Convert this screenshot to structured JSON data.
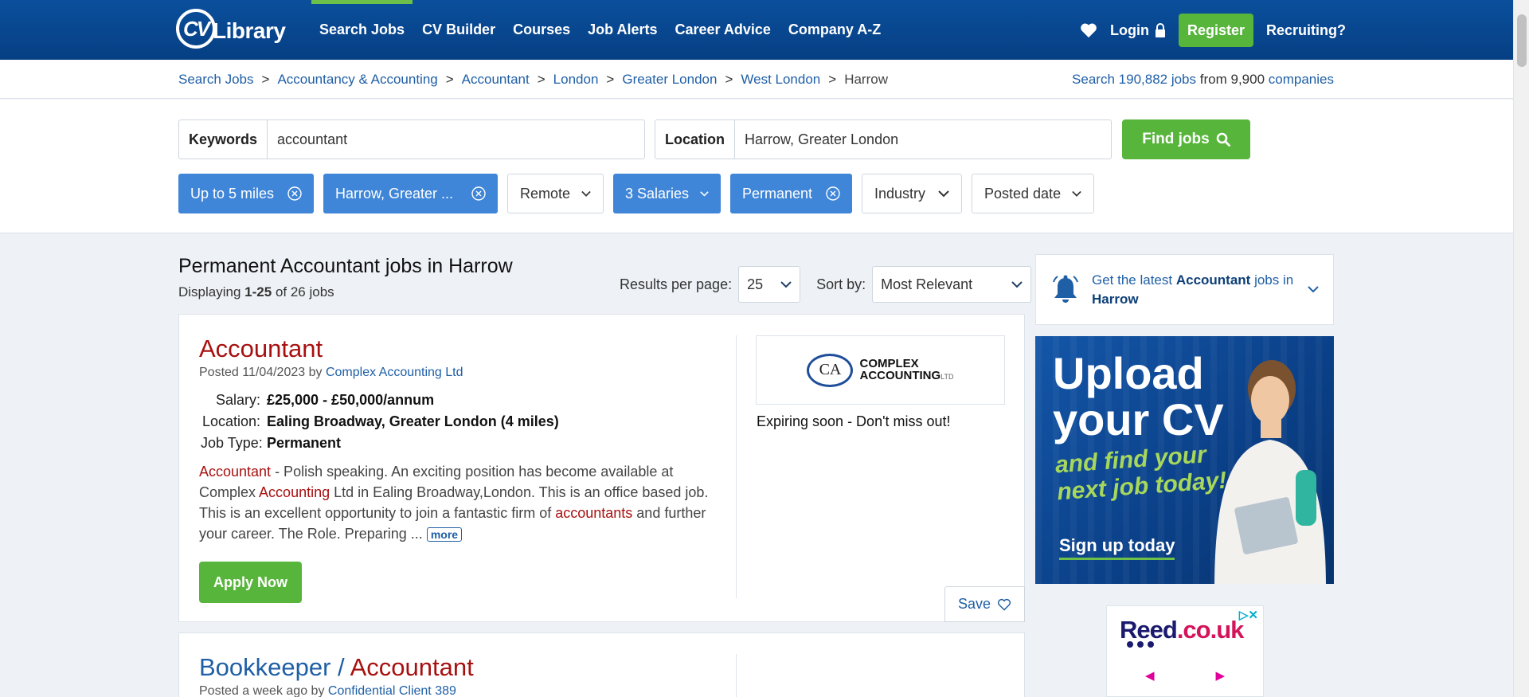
{
  "header": {
    "logo_text": "CV-Library",
    "logo_cv": "CV",
    "logo_library": "Library",
    "nav": [
      "Search Jobs",
      "CV Builder",
      "Courses",
      "Job Alerts",
      "Career Advice",
      "Company A-Z"
    ],
    "login": "Login",
    "register": "Register",
    "recruiting": "Recruiting?"
  },
  "breadcrumb": [
    "Search Jobs",
    "Accountancy & Accounting",
    "Accountant",
    "London",
    "Greater London",
    "West London",
    "Harrow"
  ],
  "stats": {
    "search": "Search",
    "jobs": "190,882 jobs",
    "from": "from",
    "companies_count": "9,900",
    "companies": "companies"
  },
  "search": {
    "keywords_label": "Keywords",
    "keywords_value": "accountant",
    "location_label": "Location",
    "location_value": "Harrow, Greater London",
    "find_label": "Find jobs"
  },
  "filters": [
    {
      "label": "Up to 5 miles",
      "active": true
    },
    {
      "label": "Harrow, Greater ...",
      "active": true
    },
    {
      "label": "Remote",
      "active": false
    },
    {
      "label": "3 Salaries",
      "active": true
    },
    {
      "label": "Permanent",
      "active": true
    },
    {
      "label": "Industry",
      "active": false
    },
    {
      "label": "Posted date",
      "active": false
    }
  ],
  "results": {
    "title": "Permanent Accountant jobs in Harrow",
    "displaying": "Displaying",
    "range": "1-25",
    "of_total": "of 26 jobs",
    "per_page_label": "Results per page:",
    "per_page_value": "25",
    "sort_label": "Sort by:",
    "sort_value": "Most Relevant"
  },
  "job1": {
    "title": "Accountant",
    "posted": "Posted 11/04/2023 by",
    "company": "Complex Accounting Ltd",
    "salary_label": "Salary:",
    "salary": "£25,000 - £50,000/annum",
    "location_label": "Location:",
    "location": "Ealing Broadway, Greater London (4 miles)",
    "type_label": "Job Type:",
    "type": "Permanent",
    "desc": {
      "w1": "Accountant",
      "t1": " - Polish speaking. An exciting position has become available at Complex ",
      "w2": "Accounting",
      "t2": " Ltd in Ealing Broadway,London. This is an office based job. This is an excellent opportunity to join a fantastic firm of ",
      "w3": "accountants",
      "t3": " and further your career. The Role. Preparing ... "
    },
    "more": "more",
    "apply": "Apply Now",
    "logo_mark": "CA",
    "logo_line1": "COMPLEX",
    "logo_line2": "ACCOUNTING",
    "logo_ltd": "LTD",
    "expiring": "Expiring soon - Don't miss out!",
    "save": "Save"
  },
  "job2": {
    "title_part1": "Bookkeeper / ",
    "title_part2": "Accountant",
    "posted": "Posted a week ago by",
    "company": "Confidential Client 389"
  },
  "sidebar": {
    "alert_pre": "Get the latest ",
    "alert_kw": "Accountant",
    "alert_mid": " jobs in ",
    "alert_loc": "Harrow",
    "promo_line1": "Upload",
    "promo_line2": "your CV",
    "promo_line3": "and find your",
    "promo_line4": "next job today!",
    "promo_cta": "Sign up today",
    "ad_brand": "Reed",
    "ad_domain": ".co.uk"
  },
  "colors": {
    "brand_blue": "#0a4f9c",
    "green": "#58b53b",
    "chip_blue": "#3f86d8",
    "job_red": "#a81010",
    "link_blue": "#1f5fa6"
  },
  "icons": [
    "heart-icon",
    "lock-icon",
    "search-icon",
    "close-circle-icon",
    "chevron-down-icon",
    "bell-icon"
  ]
}
